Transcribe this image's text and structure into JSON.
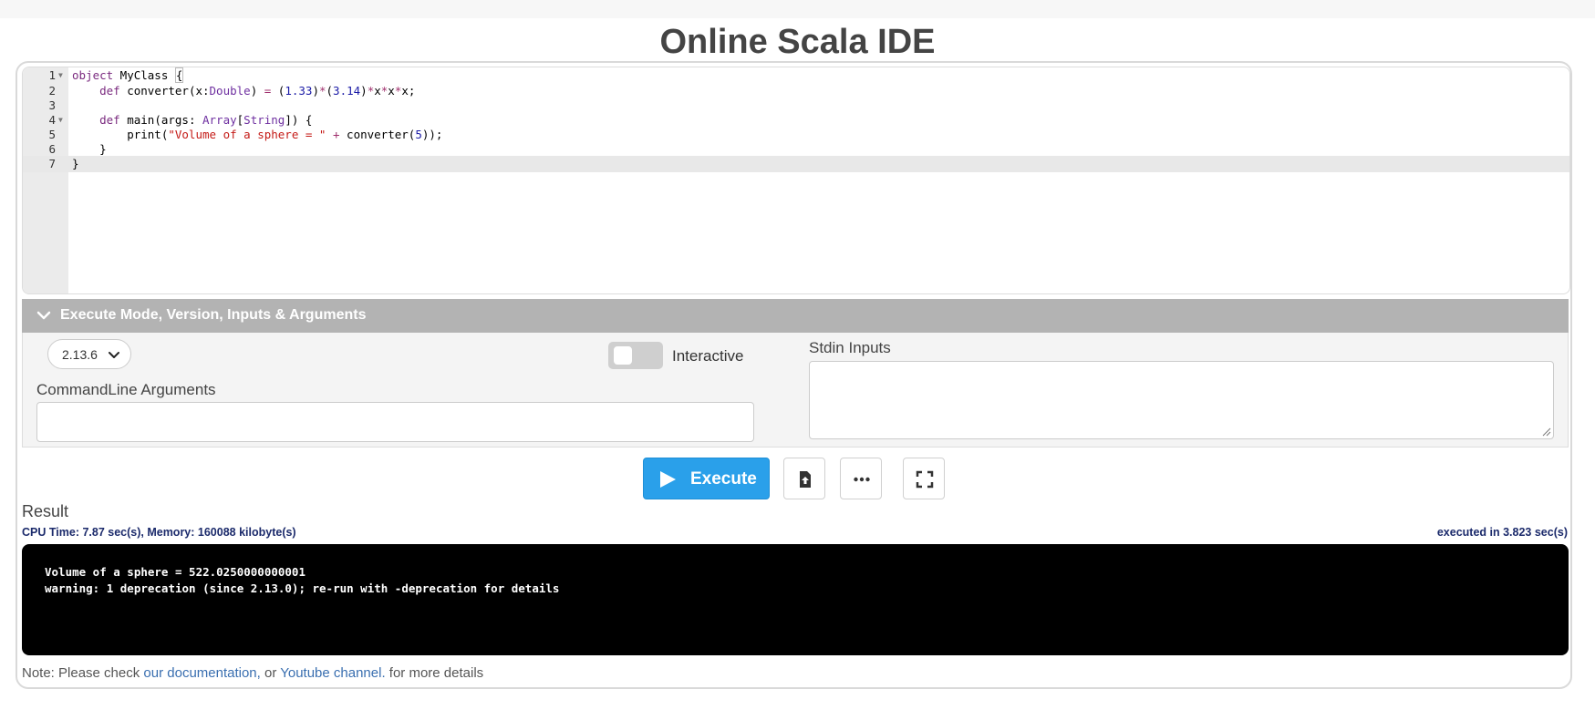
{
  "page": {
    "title": "Online Scala IDE"
  },
  "editor": {
    "lines": [
      {
        "n": "1",
        "fold": true
      },
      {
        "n": "2",
        "fold": false
      },
      {
        "n": "3",
        "fold": false
      },
      {
        "n": "4",
        "fold": true
      },
      {
        "n": "5",
        "fold": false
      },
      {
        "n": "6",
        "fold": false
      },
      {
        "n": "7",
        "fold": false
      }
    ],
    "tokens": {
      "l1": [
        "object",
        " MyClass ",
        "{"
      ],
      "l2": [
        "    ",
        "def",
        " converter(x:",
        "Double",
        ") ",
        "=",
        " (",
        "1.33",
        ")",
        "*",
        "(",
        "3.14",
        ")",
        "*",
        "x",
        "*",
        "x",
        "*",
        "x;"
      ],
      "l4": [
        "    ",
        "def",
        " main(args: ",
        "Array",
        "[",
        "String",
        "]) {"
      ],
      "l5": [
        "        print(",
        "\"Volume of a sphere = \"",
        " ",
        "+",
        " converter(",
        "5",
        "));"
      ],
      "l6": [
        "    }"
      ],
      "l7": [
        "}"
      ]
    }
  },
  "options": {
    "header": "Execute Mode, Version, Inputs & Arguments",
    "version": "2.13.6",
    "interactive_label": "Interactive",
    "interactive_on": false,
    "cmd_label": "CommandLine Arguments",
    "cmd_value": "",
    "stdin_label": "Stdin Inputs",
    "stdin_value": ""
  },
  "actions": {
    "execute_label": "Execute",
    "icons": [
      "file-upload-icon",
      "more-horizontal-icon",
      "fullscreen-icon"
    ]
  },
  "result": {
    "label": "Result",
    "cpu_info": "CPU Time: 7.87 sec(s), Memory: 160088 kilobyte(s)",
    "exec_time": "executed in 3.823 sec(s)",
    "output_lines": [
      "Volume of a sphere = 522.0250000000001",
      "warning: 1 deprecation (since 2.13.0); re-run with -deprecation for details"
    ]
  },
  "note": {
    "prefix": "Note: Please check ",
    "link1": "our documentation,",
    "middle": " or ",
    "link2": "Youtube channel.",
    "suffix": " for more details"
  },
  "colors": {
    "accent": "#2aa0ea",
    "header_bg": "#b3b3b3",
    "output_bg": "#000000",
    "link": "#3a6fb0"
  }
}
